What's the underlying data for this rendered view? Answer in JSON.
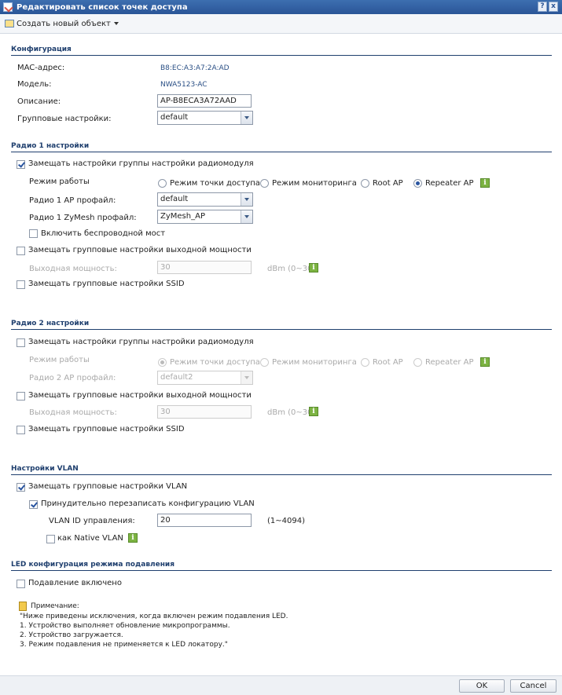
{
  "window": {
    "title": "Редактировать список точек доступа",
    "help": "?",
    "close": "x"
  },
  "toolbar": {
    "create_label": "Создать новый объект"
  },
  "config": {
    "section": "Конфигурация",
    "mac_label": "MAC-адрес:",
    "mac_value": "B8:EC:A3:A7:2A:AD",
    "model_label": "Модель:",
    "model_value": "NWA5123-AC",
    "desc_label": "Описание:",
    "desc_value": "AP-B8ECA3A72AAD",
    "group_label": "Групповые настройки:",
    "group_value": "default"
  },
  "radio1": {
    "section": "Радио 1 настройки",
    "override_radio": "Замещать настройки группы настройки радиомодуля",
    "mode_label": "Режим работы",
    "modes": [
      "Режим точки доступа",
      "Режим мониторинга",
      "Root AP",
      "Repeater AP"
    ],
    "selected_mode": "Repeater AP",
    "ap_profile_label": "Радио 1 AP профайл:",
    "ap_profile_value": "default",
    "zymesh_label": "Радио 1 ZyMesh профайл:",
    "zymesh_value": "ZyMesh_AP",
    "bridge_label": "Включить беспроводной мост",
    "override_power": "Замещать групповые настройки выходной мощности",
    "power_label": "Выходная мощность:",
    "power_value": "30",
    "power_unit": "dBm (0~30)",
    "override_ssid": "Замещать групповые настройки SSID"
  },
  "radio2": {
    "section": "Радио 2 настройки",
    "override_radio": "Замещать настройки группы настройки радиомодуля",
    "mode_label": "Режим работы",
    "modes": [
      "Режим точки доступа",
      "Режим мониторинга",
      "Root AP",
      "Repeater AP"
    ],
    "ap_profile_label": "Радио 2 AP профайл:",
    "ap_profile_value": "default2",
    "override_power": "Замещать групповые настройки выходной мощности",
    "power_label": "Выходная мощность:",
    "power_value": "30",
    "power_unit": "dBm (0~30)",
    "override_ssid": "Замещать групповые настройки SSID"
  },
  "vlan": {
    "section": "Настройки VLAN",
    "override": "Замещать групповые настройки VLAN",
    "force": "Принудительно перезаписать конфигурацию VLAN",
    "id_label": "VLAN ID управления:",
    "id_value": "20",
    "id_range": "(1~4094)",
    "native": "как Native VLAN"
  },
  "led": {
    "section": "LED конфигурация режима подавления",
    "suppress": "Подавление включено",
    "note_title": "Примечание:",
    "note_lines": [
      "\"Ниже приведены исключения, когда включен режим подавления LED.",
      "1. Устройство выполняет обновление микропрограммы.",
      "2. Устройство загружается.",
      "3. Режим подавления не применяется к LED локатору.\""
    ]
  },
  "footer": {
    "ok": "OK",
    "cancel": "Cancel"
  },
  "colors": {
    "titlebar": "#2a5597",
    "section": "#1f3f6e",
    "info": "#7cb342"
  }
}
